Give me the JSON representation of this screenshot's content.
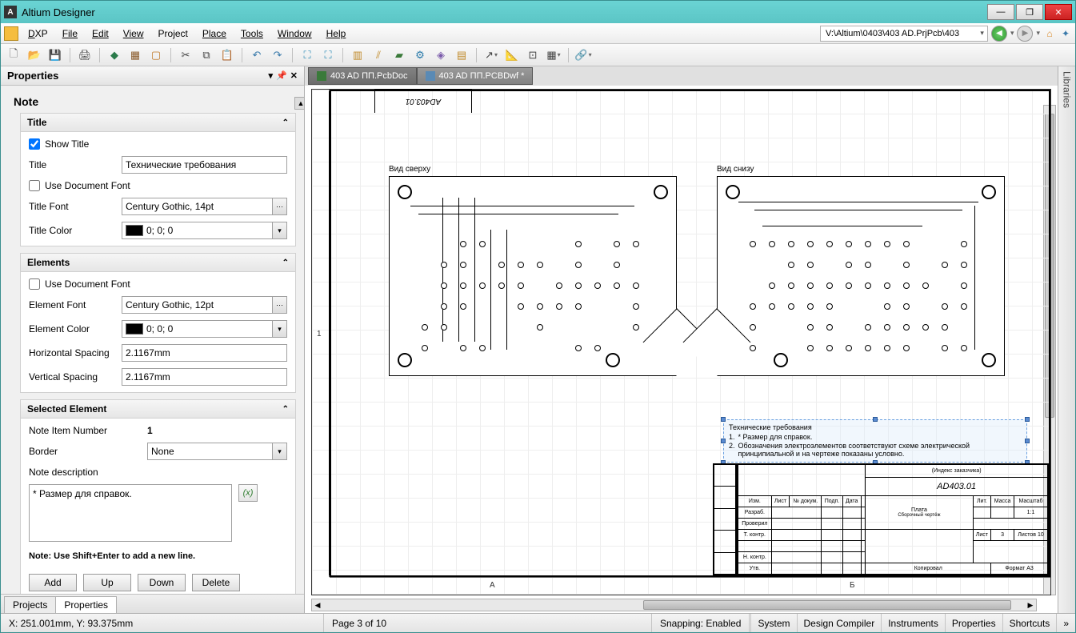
{
  "app": {
    "title": "Altium Designer"
  },
  "window_buttons": {
    "min": "—",
    "max": "❐",
    "close": "✕"
  },
  "menu": {
    "dxp": "DXP",
    "file": "File",
    "edit": "Edit",
    "view": "View",
    "project": "Project",
    "place": "Place",
    "tools": "Tools",
    "window": "Window",
    "help": "Help"
  },
  "project_path": "V:\\Altium\\0403\\403 AD.PrjPcb\\403",
  "properties_panel": {
    "title": "Properties",
    "section": "Note",
    "title_group": {
      "heading": "Title",
      "show_title": "Show Title",
      "title_label": "Title",
      "title_value": "Технические требования",
      "use_doc_font": "Use Document Font",
      "title_font_label": "Title Font",
      "title_font_value": "Century Gothic, 14pt",
      "title_color_label": "Title Color",
      "title_color_value": "0; 0; 0"
    },
    "elements_group": {
      "heading": "Elements",
      "use_doc_font": "Use Document Font",
      "el_font_label": "Element Font",
      "el_font_value": "Century Gothic, 12pt",
      "el_color_label": "Element Color",
      "el_color_value": "0; 0; 0",
      "hspace_label": "Horizontal Spacing",
      "hspace_value": "2.1167mm",
      "vspace_label": "Vertical Spacing",
      "vspace_value": "2.1167mm"
    },
    "selected_group": {
      "heading": "Selected Element",
      "item_num_label": "Note Item Number",
      "item_num_value": "1",
      "border_label": "Border",
      "border_value": "None",
      "desc_label": "Note description",
      "desc_value": "* Размер для справок.",
      "hint": "Note: Use Shift+Enter to add a new line.",
      "btn_add": "Add",
      "btn_up": "Up",
      "btn_down": "Down",
      "btn_del": "Delete"
    }
  },
  "bottom_tabs": {
    "projects": "Projects",
    "properties": "Properties"
  },
  "doc_tabs": {
    "tab1": "403 AD ПП.PcbDoc",
    "tab2": "403 AD ПП.PCBDwf *"
  },
  "drawing": {
    "top_block": "AD403.01",
    "view_top": "Вид сверху",
    "view_bottom": "Вид снизу",
    "ruler_num": "1",
    "ruler_bottom_a": "А",
    "ruler_bottom_b": "Б",
    "notes": {
      "title": "Технические требования",
      "line1_num": "1.",
      "line1": "* Размер для справок.",
      "line2_num": "2.",
      "line2": "Обозначения электроэлементов соответствуют схеме электрической принципиальной и на чертеже показаны условно."
    },
    "stamp": {
      "index": "(Индекс заказчика)",
      "code": "AD403.01",
      "name": "Плата",
      "subtitle": "Сборочный чертёж",
      "lit": "Лит.",
      "massa": "Масса",
      "masht": "Масштаб",
      "scale": "1:1",
      "list": "Лист",
      "list_n": "3",
      "listov": "Листов",
      "listov_n": "10",
      "izm": "Изм.",
      "list2": "Лист",
      "ndokum": "№ докум.",
      "podp": "Подп.",
      "data": "Дата",
      "razrab": "Разраб.",
      "prover": "Проверил",
      "tkontr": "Т. контр.",
      "nkontr": "Н. контр.",
      "utv": "Утв.",
      "kopiroval": "Копировал",
      "format": "Формат A3"
    }
  },
  "status": {
    "coords": "X: 251.001mm, Y: 93.375mm",
    "page": "Page 3 of 10",
    "snap": "Snapping: Enabled",
    "system": "System",
    "dc": "Design Compiler",
    "instr": "Instruments",
    "props": "Properties",
    "short": "Shortcuts"
  },
  "right_rail": "Libraries"
}
